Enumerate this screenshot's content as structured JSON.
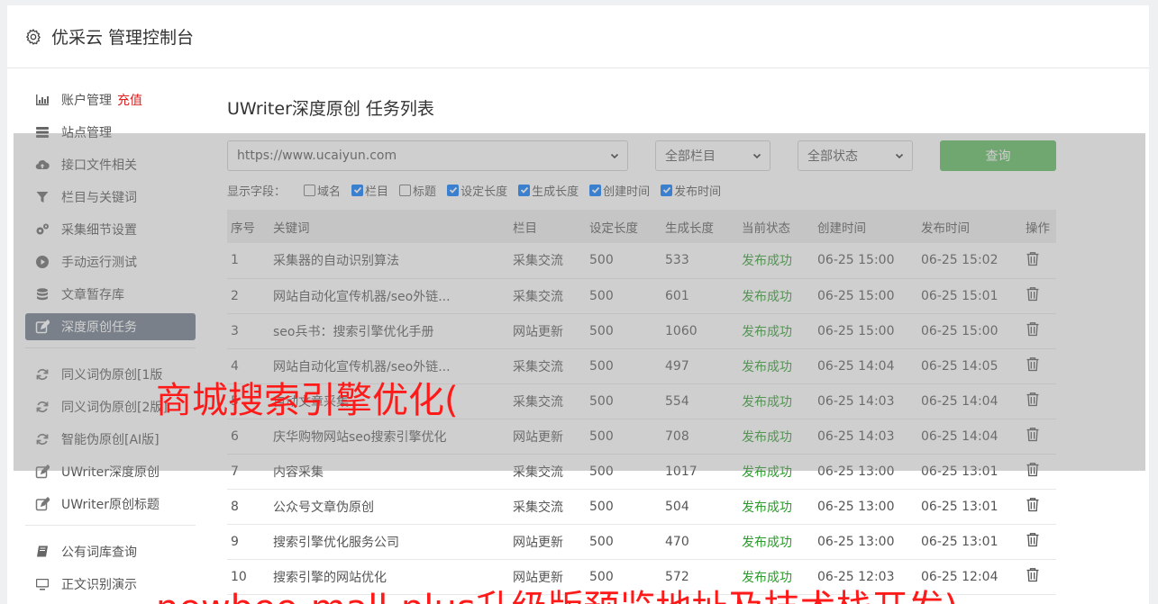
{
  "header": {
    "title": "优采云 管理控制台",
    "icon": "gear-icon"
  },
  "sidebar": {
    "group1": [
      {
        "label": "账户管理",
        "extra": "充值",
        "icon": "bar-chart-icon"
      },
      {
        "label": "站点管理",
        "icon": "server-icon"
      },
      {
        "label": "接口文件相关",
        "icon": "cloud-upload-icon"
      },
      {
        "label": "栏目与关键词",
        "icon": "filter-icon"
      },
      {
        "label": "采集细节设置",
        "icon": "gears-icon"
      },
      {
        "label": "手动运行测试",
        "icon": "play-circle-icon"
      },
      {
        "label": "文章暂存库",
        "icon": "database-icon"
      },
      {
        "label": "深度原创任务",
        "icon": "edit-icon",
        "active": true
      }
    ],
    "group2": [
      {
        "label": "同义词伪原创[1版",
        "icon": "refresh-icon"
      },
      {
        "label": "同义词伪原创[2版]",
        "icon": "refresh-icon"
      },
      {
        "label": "智能伪原创[AI版]",
        "icon": "refresh-icon"
      },
      {
        "label": "UWriter深度原创",
        "icon": "edit-icon"
      },
      {
        "label": "UWriter原创标题",
        "icon": "edit-icon"
      }
    ],
    "group3": [
      {
        "label": "公有词库查询",
        "icon": "book-icon"
      },
      {
        "label": "正文识别演示",
        "icon": "monitor-icon"
      }
    ]
  },
  "main": {
    "title": "UWriter深度原创 任务列表",
    "filters": {
      "site": "https://www.ucaiyun.com",
      "column": "全部栏目",
      "status": "全部状态",
      "query_label": "查询"
    },
    "fields_label": "显示字段：",
    "fields": [
      {
        "label": "域名",
        "checked": false
      },
      {
        "label": "栏目",
        "checked": true
      },
      {
        "label": "标题",
        "checked": false
      },
      {
        "label": "设定长度",
        "checked": true
      },
      {
        "label": "生成长度",
        "checked": true
      },
      {
        "label": "创建时间",
        "checked": true
      },
      {
        "label": "发布时间",
        "checked": true
      }
    ],
    "table": {
      "headers": [
        "序号",
        "关键词",
        "栏目",
        "设定长度",
        "生成长度",
        "当前状态",
        "创建时间",
        "发布时间",
        "操作"
      ],
      "rows": [
        [
          "1",
          "采集器的自动识别算法",
          "采集交流",
          "500",
          "533",
          "发布成功",
          "06-25 15:00",
          "06-25 15:02"
        ],
        [
          "2",
          "网站自动化宣传机器/seo外链...",
          "采集交流",
          "500",
          "601",
          "发布成功",
          "06-25 15:00",
          "06-25 15:01"
        ],
        [
          "3",
          "seo兵书：搜索引擎优化手册",
          "网站更新",
          "500",
          "1060",
          "发布成功",
          "06-25 15:00",
          "06-25 15:00"
        ],
        [
          "4",
          "网站自动化宣传机器/seo外链...",
          "采集交流",
          "500",
          "497",
          "发布成功",
          "06-25 14:04",
          "06-25 14:05"
        ],
        [
          "5",
          "自动文章采集",
          "采集交流",
          "500",
          "554",
          "发布成功",
          "06-25 14:03",
          "06-25 14:04"
        ],
        [
          "6",
          "庆华购物网站seo搜索引擎优化",
          "网站更新",
          "500",
          "708",
          "发布成功",
          "06-25 14:03",
          "06-25 14:04"
        ],
        [
          "7",
          "内容采集",
          "采集交流",
          "500",
          "1017",
          "发布成功",
          "06-25 13:00",
          "06-25 13:01"
        ],
        [
          "8",
          "公众号文章伪原创",
          "采集交流",
          "500",
          "504",
          "发布成功",
          "06-25 13:00",
          "06-25 13:01"
        ],
        [
          "9",
          "搜索引擎优化服务公司",
          "网站更新",
          "500",
          "470",
          "发布成功",
          "06-25 13:00",
          "06-25 13:01"
        ],
        [
          "10",
          "搜索引擎的网站优化",
          "网站更新",
          "500",
          "572",
          "发布成功",
          "06-25 12:03",
          "06-25 12:04"
        ]
      ]
    }
  },
  "watermarks": {
    "line1": "商城搜索引擎优化(",
    "line2": "newbee-mall-plus升级版预览地址及技术栈开发)"
  },
  "colors": {
    "active_bg": "#6c7789",
    "success": "#2c9a2c",
    "query_button": "#5cb85c",
    "accent_red": "#e02020"
  }
}
